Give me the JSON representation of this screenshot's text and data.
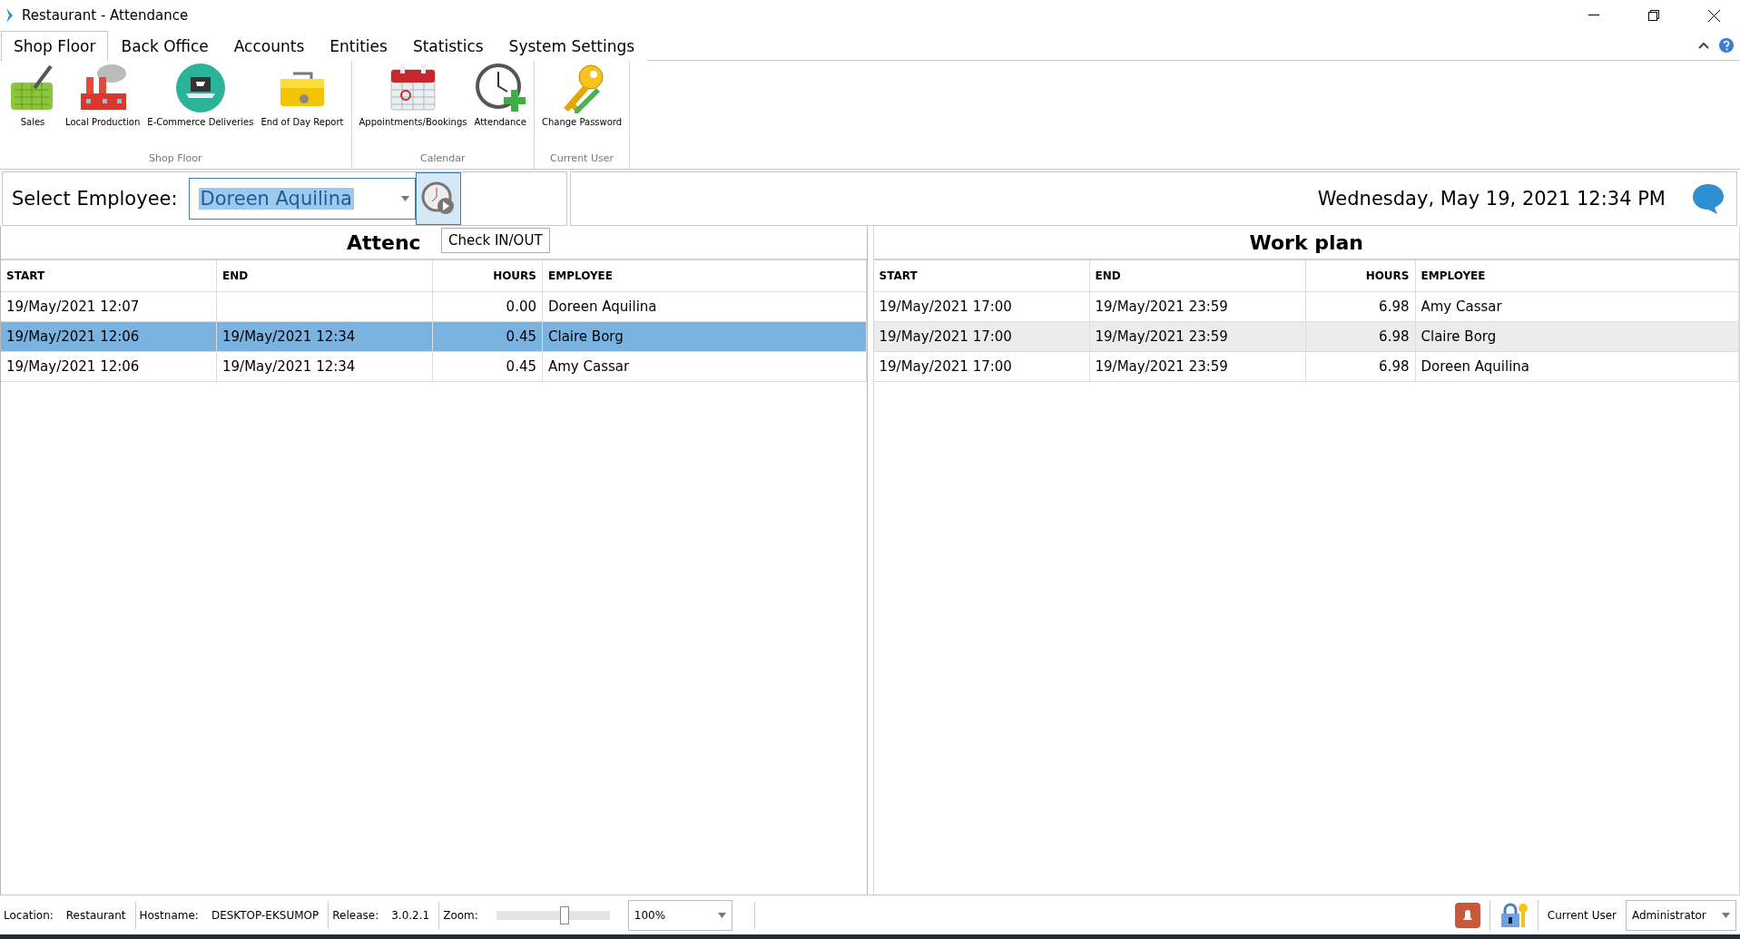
{
  "window": {
    "title": "Restaurant - Attendance"
  },
  "tabs": [
    {
      "label": "Shop Floor",
      "selected": true
    },
    {
      "label": "Back Office",
      "selected": false
    },
    {
      "label": "Accounts",
      "selected": false
    },
    {
      "label": "Entities",
      "selected": false
    },
    {
      "label": "Statistics",
      "selected": false
    },
    {
      "label": "System Settings",
      "selected": false
    }
  ],
  "ribbon_groups": [
    {
      "label": "Shop Floor",
      "items": [
        {
          "kind": "basket",
          "label": "Sales"
        },
        {
          "kind": "factory",
          "label": "Local Production"
        },
        {
          "kind": "laptop",
          "label": "E-Commerce Deliveries"
        },
        {
          "kind": "cashbox",
          "label": "End of Day Report"
        }
      ]
    },
    {
      "label": "Calendar",
      "items": [
        {
          "kind": "calendar",
          "label": "Appointments/Bookings"
        },
        {
          "kind": "clock",
          "label": "Attendance"
        }
      ]
    },
    {
      "label": "Current User",
      "items": [
        {
          "kind": "key",
          "label": "Change Password"
        }
      ]
    }
  ],
  "employee_bar": {
    "label": "Select Employee:",
    "value": "Doreen Aquilina",
    "tooltip": "Check IN/OUT",
    "datetime": "Wednesday, May 19, 2021 12:34 PM"
  },
  "panels": [
    {
      "title": "Attenc",
      "focused": true,
      "columns": [
        "START",
        "END",
        "HOURS",
        "EMPLOYEE"
      ],
      "rows": [
        {
          "cells": [
            "19/May/2021 12:07",
            "",
            "0.00",
            "Doreen Aquilina"
          ],
          "selected": false
        },
        {
          "cells": [
            "19/May/2021 12:06",
            "19/May/2021 12:34",
            "0.45",
            "Claire Borg"
          ],
          "selected": true
        },
        {
          "cells": [
            "19/May/2021 12:06",
            "19/May/2021 12:34",
            "0.45",
            "Amy Cassar"
          ],
          "selected": false
        }
      ]
    },
    {
      "title": "Work plan",
      "focused": false,
      "columns": [
        "START",
        "END",
        "HOURS",
        "EMPLOYEE"
      ],
      "rows": [
        {
          "cells": [
            "19/May/2021 17:00",
            "19/May/2021 23:59",
            "6.98",
            "Amy Cassar"
          ],
          "selected": false
        },
        {
          "cells": [
            "19/May/2021 17:00",
            "19/May/2021 23:59",
            "6.98",
            "Claire Borg"
          ],
          "selected": true
        },
        {
          "cells": [
            "19/May/2021 17:00",
            "19/May/2021 23:59",
            "6.98",
            "Doreen Aquilina"
          ],
          "selected": false
        }
      ]
    }
  ],
  "status_bar": {
    "fields": [
      {
        "label": "Location:",
        "value": "Restaurant"
      },
      {
        "label": "Hostname:",
        "value": "DESKTOP-EKSUMOP"
      },
      {
        "label": "Release:",
        "value": "3.0.2.1"
      }
    ],
    "zoom_label": "Zoom:",
    "zoom_slider": {
      "level": 0.6
    },
    "zoom_value": "100%",
    "user_label": "Current User",
    "user_value": "Administrator"
  }
}
